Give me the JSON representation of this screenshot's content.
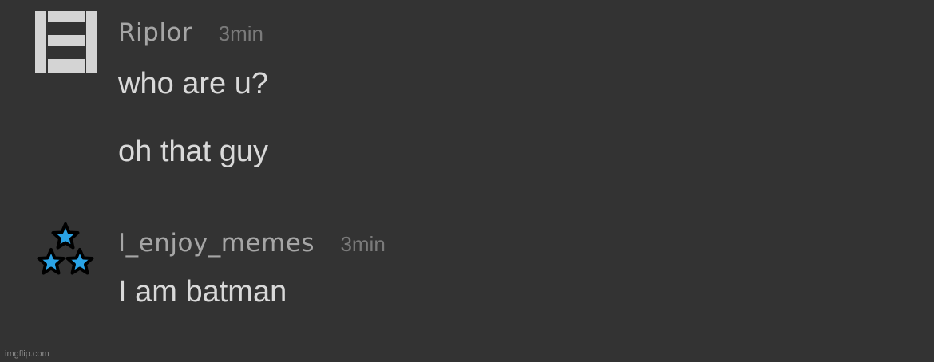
{
  "messages": [
    {
      "username": "Riplor",
      "timestamp": "3min",
      "avatar_icon": "pixel-block-avatar-icon",
      "lines": [
        "who are u?",
        "oh that guy"
      ]
    },
    {
      "username": "I_enjoy_memes",
      "timestamp": "3min",
      "avatar_icon": "three-stars-avatar-icon",
      "lines": [
        "I am batman"
      ]
    }
  ],
  "colors": {
    "background": "#333333",
    "username": "#a6a6a6",
    "timestamp": "#7a7a7a",
    "message_text": "#d9d9d9",
    "star_fill": "#2aa3e6",
    "star_outline": "#000000",
    "pixel_avatar": "#d4d4d4"
  },
  "watermark": "imgflip.com"
}
